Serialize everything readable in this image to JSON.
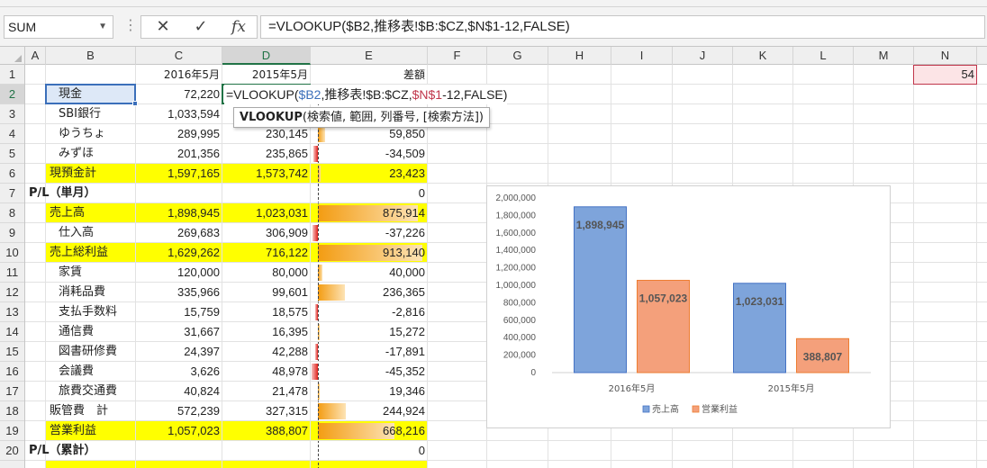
{
  "formula_bar": {
    "name_box": "SUM",
    "formula": "=VLOOKUP($B2,推移表!$B:$CZ,$N$1-12,FALSE)"
  },
  "icons": {
    "cancel": "x-icon",
    "enter": "checkmark-icon",
    "function": "fx-icon",
    "dropdown": "chevron-down-icon"
  },
  "columns": [
    "A",
    "B",
    "C",
    "D",
    "E",
    "F",
    "G",
    "H",
    "I",
    "J",
    "K",
    "L",
    "M",
    "N"
  ],
  "active_column": "D",
  "active_row": "2",
  "rows": [
    "1",
    "2",
    "3",
    "4",
    "5",
    "6",
    "7",
    "8",
    "9",
    "10",
    "11",
    "12",
    "13",
    "14",
    "15",
    "16",
    "17",
    "18",
    "19",
    "20"
  ],
  "headers": {
    "c1": "2016年5月",
    "d1": "2015年5月",
    "e1": "差額",
    "n1": "54"
  },
  "table": [
    {
      "label": "現金",
      "c": "72,220",
      "d": "",
      "e": "",
      "indent": true,
      "highlight": false,
      "bar": 0
    },
    {
      "label": "SBI銀行",
      "c": "1,033,594",
      "d": "",
      "e": "",
      "indent": true,
      "highlight": false,
      "bar": 0
    },
    {
      "label": "ゆうちょ",
      "c": "289,995",
      "d": "230,145",
      "e": "59,850",
      "indent": true,
      "highlight": false,
      "bar": 59850
    },
    {
      "label": "みずほ",
      "c": "201,356",
      "d": "235,865",
      "e": "-34,509",
      "indent": true,
      "highlight": false,
      "bar": -34509
    },
    {
      "label": "現預金計",
      "c": "1,597,165",
      "d": "1,573,742",
      "e": "23,423",
      "indent": false,
      "highlight": true,
      "bar": 23423
    },
    {
      "label": "P/L（単月）",
      "c": "",
      "d": "",
      "e": "0",
      "indent": false,
      "highlight": false,
      "section": true,
      "bar": 0
    },
    {
      "label": "売上高",
      "c": "1,898,945",
      "d": "1,023,031",
      "e": "875,914",
      "indent": false,
      "highlight": true,
      "bar": 875914
    },
    {
      "label": "仕入高",
      "c": "269,683",
      "d": "306,909",
      "e": "-37,226",
      "indent": true,
      "highlight": false,
      "bar": -37226
    },
    {
      "label": "売上総利益",
      "c": "1,629,262",
      "d": "716,122",
      "e": "913,140",
      "indent": false,
      "highlight": true,
      "bar": 913140
    },
    {
      "label": "家賃",
      "c": "120,000",
      "d": "80,000",
      "e": "40,000",
      "indent": true,
      "highlight": false,
      "bar": 40000
    },
    {
      "label": "消耗品費",
      "c": "335,966",
      "d": "99,601",
      "e": "236,365",
      "indent": true,
      "highlight": false,
      "bar": 236365
    },
    {
      "label": "支払手数料",
      "c": "15,759",
      "d": "18,575",
      "e": "-2,816",
      "indent": true,
      "highlight": false,
      "bar": -2816
    },
    {
      "label": "通信費",
      "c": "31,667",
      "d": "16,395",
      "e": "15,272",
      "indent": true,
      "highlight": false,
      "bar": 15272
    },
    {
      "label": "図書研修費",
      "c": "24,397",
      "d": "42,288",
      "e": "-17,891",
      "indent": true,
      "highlight": false,
      "bar": -17891
    },
    {
      "label": "会議費",
      "c": "3,626",
      "d": "48,978",
      "e": "-45,352",
      "indent": true,
      "highlight": false,
      "bar": -45352
    },
    {
      "label": "旅費交通費",
      "c": "40,824",
      "d": "21,478",
      "e": "19,346",
      "indent": true,
      "highlight": false,
      "bar": 19346
    },
    {
      "label": "販管費　計",
      "c": "572,239",
      "d": "327,315",
      "e": "244,924",
      "indent": false,
      "highlight": false,
      "bar": 244924
    },
    {
      "label": "営業利益",
      "c": "1,057,023",
      "d": "388,807",
      "e": "668,216",
      "indent": false,
      "highlight": true,
      "bar": 668216
    },
    {
      "label": "P/L（累計）",
      "c": "",
      "d": "",
      "e": "0",
      "indent": false,
      "highlight": false,
      "section": true,
      "bar": 0
    }
  ],
  "cell_edit": {
    "prefix": "=VLOOKUP(",
    "ref_b2": "$B2",
    "middle": ",推移表!$B:$CZ,",
    "ref_n1": "$N$1",
    "suffix": "-12,FALSE)"
  },
  "tooltip": {
    "function": "VLOOKUP",
    "args": "(検索値, 範囲, 列番号, [検索方法])"
  },
  "colors": {
    "highlight_yellow": "#ffff00",
    "bar_orange": "#f39c12",
    "bar_red": "#e0201b",
    "series1": "#7ea4db",
    "series2": "#f4a07b"
  },
  "chart_data": {
    "type": "bar",
    "categories": [
      "2016年5月",
      "2015年5月"
    ],
    "series": [
      {
        "name": "売上高",
        "values": [
          1898945,
          1023031
        ],
        "labels": [
          "1,898,945",
          "1,023,031"
        ],
        "color": "#7ea4db"
      },
      {
        "name": "営業利益",
        "values": [
          1057023,
          388807
        ],
        "labels": [
          "1,057,023",
          "388,807"
        ],
        "color": "#f4a07b"
      }
    ],
    "ylim": [
      0,
      2000000
    ],
    "yticks": [
      0,
      200000,
      400000,
      600000,
      800000,
      1000000,
      1200000,
      1400000,
      1600000,
      1800000,
      2000000
    ],
    "ytick_labels": [
      "0",
      "200,000",
      "400,000",
      "600,000",
      "800,000",
      "1,000,000",
      "1,200,000",
      "1,400,000",
      "1,600,000",
      "1,800,000",
      "2,000,000"
    ],
    "legend": "bottom",
    "grid": false
  }
}
